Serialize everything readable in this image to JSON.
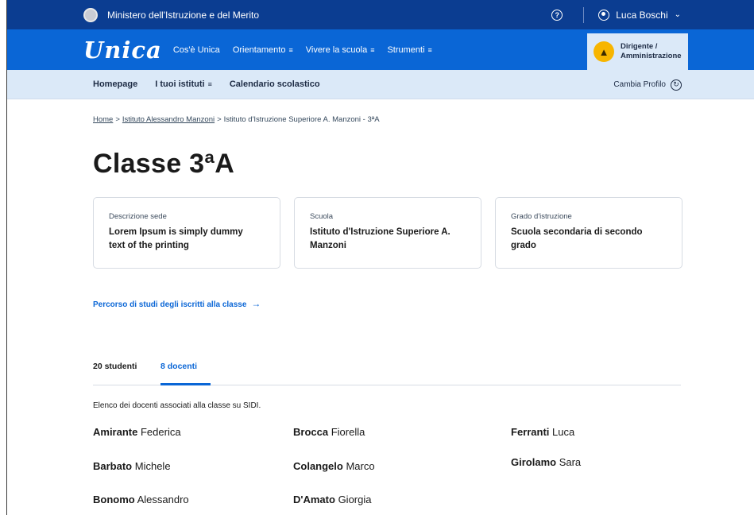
{
  "topbar": {
    "ministry": "Ministero dell'Istruzione e del Merito",
    "help_icon": "help-circle-icon",
    "user_name": "Luca Boschi",
    "user_chevron": "⌄"
  },
  "mainnav": {
    "logo": "Unica",
    "items": [
      {
        "label": "Cos'è Unica",
        "has_menu": false
      },
      {
        "label": "Orientamento",
        "has_menu": true
      },
      {
        "label": "Vivere la scuola",
        "has_menu": true
      },
      {
        "label": "Strumenti",
        "has_menu": true
      }
    ],
    "menu_glyph": "≡",
    "role_line1": "Dirigente /",
    "role_line2": "Amministrazione"
  },
  "subnav": {
    "items": [
      {
        "label": "Homepage",
        "has_menu": false
      },
      {
        "label": "I tuoi istituti",
        "has_menu": true
      },
      {
        "label": "Calendario scolastico",
        "has_menu": false
      }
    ],
    "menu_glyph": "≡",
    "cambia_profilo": "Cambia Profilo"
  },
  "breadcrumb": {
    "items": [
      "Home",
      "Istituto Alessandro Manzoni",
      "Istituto d'Istruzione Superiore A. Manzoni - 3ªA"
    ],
    "separator": ">"
  },
  "page_title": "Classe 3ªA",
  "cards": [
    {
      "label": "Descrizione sede",
      "value_line1": "Lorem Ipsum is simply dummy",
      "value_line2": "text of the printing"
    },
    {
      "label": "Scuola",
      "value_line1": "Istituto d'Istruzione Superiore A.",
      "value_line2": "Manzoni"
    },
    {
      "label": "Grado d'istruzione",
      "value_line1": "Scuola secondaria di secondo",
      "value_line2": "grado"
    }
  ],
  "percorso_link": "Percorso di studi degli iscritti alla classe",
  "percorso_arrow": "→",
  "tabs": {
    "students": "20 studenti",
    "teachers": "8 docenti",
    "active": "teachers"
  },
  "teachers_intro": "Elenco dei docenti associati alla classe su SIDI.",
  "teachers": [
    {
      "surname": "Amirante",
      "name": "Federica"
    },
    {
      "surname": "Barbato",
      "name": "Michele"
    },
    {
      "surname": "Bonomo",
      "name": "Alessandro"
    },
    {
      "surname": "Brocca",
      "name": "Fiorella"
    },
    {
      "surname": "Colangelo",
      "name": "Marco"
    },
    {
      "surname": "D'Amato",
      "name": "Giorgia"
    },
    {
      "surname": "Ferranti",
      "name": "Luca"
    },
    {
      "surname": "Girolamo",
      "name": "Sara"
    }
  ],
  "colors": {
    "top_bar": "#0b3d91",
    "main_nav": "#0a66d6",
    "sub_nav": "#dbe9f8",
    "accent": "#0a66d6",
    "role_badge": "#f7b500"
  }
}
